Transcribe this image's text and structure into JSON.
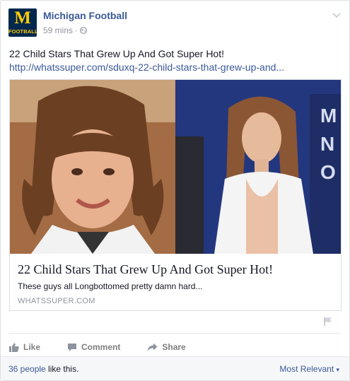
{
  "post": {
    "page_name": "Michigan Football",
    "avatar_letter": "M",
    "avatar_text": "FOOTBALL",
    "timestamp": "59 mins",
    "separator": "·",
    "message": "22 Child Stars That Grew Up And Got Super Hot!",
    "link_text": "http://whatssuper.com/sduxq-22-child-stars-that-grew-up-and..."
  },
  "card": {
    "title": "22 Child Stars That Grew Up And Got Super Hot!",
    "description": "These guys all Longbottomed pretty damn hard...",
    "domain": "WHATSSUPER.COM"
  },
  "actions": {
    "like": "Like",
    "comment": "Comment",
    "share": "Share"
  },
  "footer": {
    "likes_count": "36 people",
    "likes_suffix": " like this.",
    "sort_label": "Most Relevant",
    "sort_caret": "▾"
  },
  "colors": {
    "link": "#3b5998",
    "muted": "#90949c",
    "avatar_bg": "#00274c",
    "avatar_fg": "#ffcb05"
  },
  "icons": [
    "globe-icon",
    "chevron-down-icon",
    "flag-icon",
    "like-icon",
    "comment-icon",
    "share-icon"
  ]
}
